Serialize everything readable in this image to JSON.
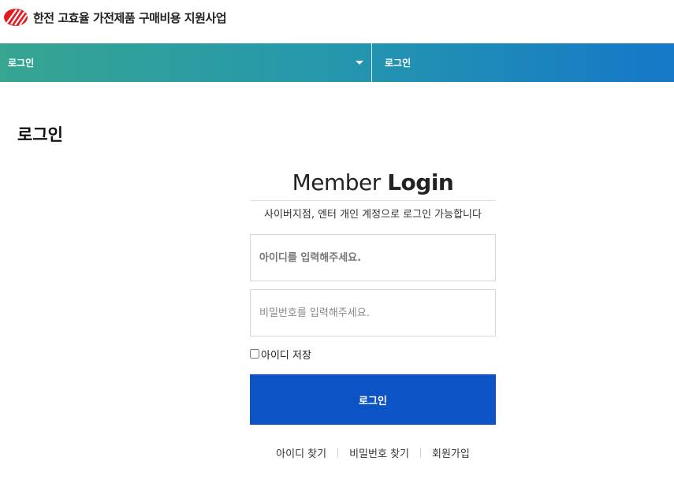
{
  "header": {
    "logo_text": "한전 고효율 가전제품 구매비용 지원사업"
  },
  "nav": {
    "left_label": "로그인",
    "right_label": "로그인"
  },
  "page": {
    "title": "로그인"
  },
  "login": {
    "heading_light": "Member",
    "heading_bold": "Login",
    "description": "사이버지점, 엔터 개인 계정으로 로그인 가능합니다",
    "id_placeholder": "아이디를 입력해주세요.",
    "pw_placeholder": "비밀번호를 입력해주세요.",
    "remember_label": "아이디 저장",
    "submit_label": "로그인"
  },
  "links": {
    "find_id": "아이디 찾기",
    "find_pw": "비밀번호 찾기",
    "signup": "회원가입"
  },
  "colors": {
    "primary_button": "#0c53c6",
    "nav_gradient_start": "#37a592",
    "nav_gradient_end": "#1578c9",
    "logo_red": "#e31b23"
  }
}
